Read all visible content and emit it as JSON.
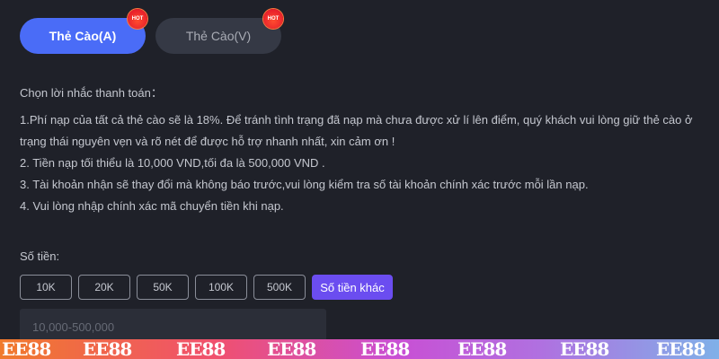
{
  "tabs": [
    {
      "label": "Thẻ Cào(A)",
      "badge": "HOT",
      "active": true
    },
    {
      "label": "Thẻ Cào(V)",
      "badge": "HOT",
      "active": false
    }
  ],
  "payment_reminder": {
    "title": "Chọn lời nhắc thanh toán：",
    "notes": [
      "1.Phí nạp của tất cả thẻ cào sẽ là 18%. Để tránh tình trạng đã nạp mà chưa được xử lí lên điểm, quý khách vui lòng giữ thẻ cào ở trạng thái nguyên vẹn và rõ nét  để được hỗ trợ nhanh nhất, xin cảm ơn !",
      "2. Tiền nạp tối thiểu là 10,000 VND,tối đa là 500,000 VND .",
      "3. Tài khoản nhận sẽ thay đổi mà không báo trước,vui lòng kiểm tra số tài khoản chính xác trước mỗi lần nạp.",
      "4. Vui lòng nhập chính xác mã chuyển tiền khi nạp."
    ]
  },
  "amount": {
    "label": "Số tiền:",
    "options": [
      "10K",
      "20K",
      "50K",
      "100K",
      "500K"
    ],
    "other_label": "Số tiền khác",
    "input_placeholder": "10,000-500,000",
    "input_value": ""
  },
  "watermark": {
    "text": "EE88",
    "repeat_count": 8
  },
  "colors": {
    "background": "#1f2129",
    "active_tab": "#4a6cf7",
    "inactive_tab": "#353945",
    "other_amount": "#6b4df0",
    "hot_badge": "#e8202c"
  }
}
